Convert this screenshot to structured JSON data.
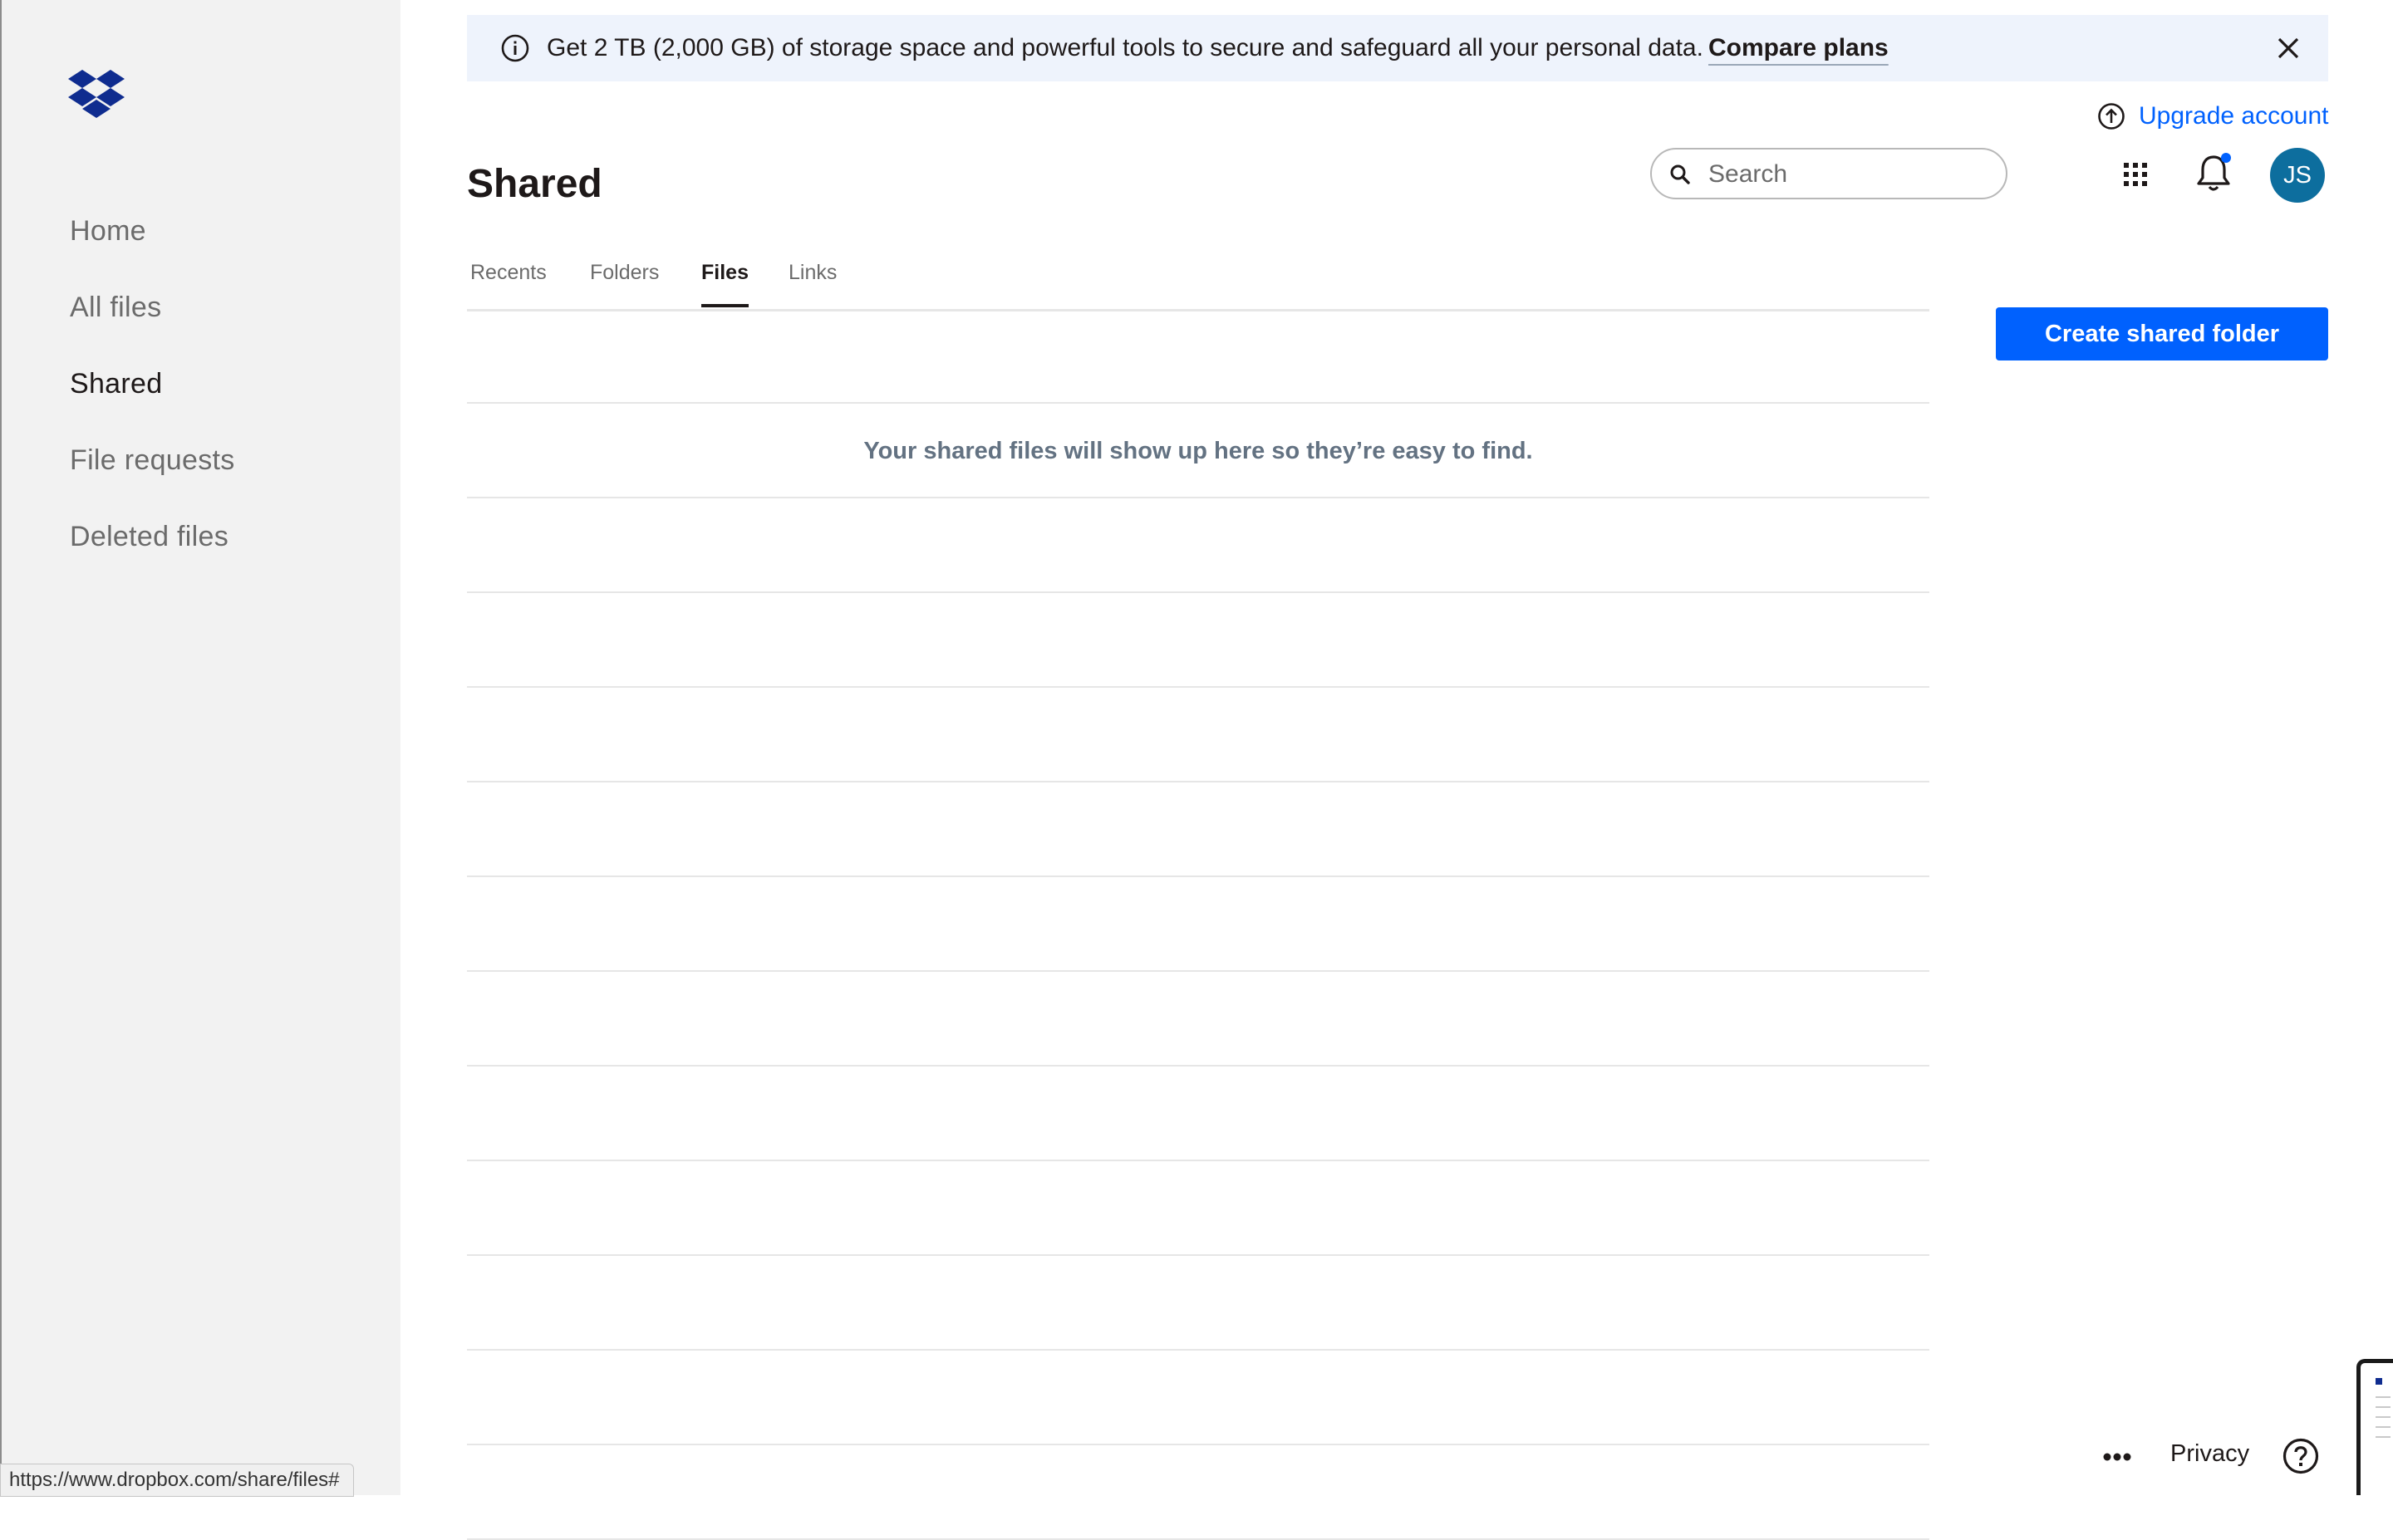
{
  "sidebar": {
    "items": [
      {
        "label": "Home",
        "active": false
      },
      {
        "label": "All files",
        "active": false
      },
      {
        "label": "Shared",
        "active": true
      },
      {
        "label": "File requests",
        "active": false
      },
      {
        "label": "Deleted files",
        "active": false
      }
    ]
  },
  "banner": {
    "icon": "info-icon",
    "message": "Get 2 TB (2,000 GB) of storage space and powerful tools to secure and safeguard all your personal data.",
    "link": "Compare plans",
    "close_icon": "close-icon"
  },
  "header": {
    "upgrade_label": "Upgrade account",
    "title": "Shared",
    "search_placeholder": "Search",
    "avatar_initials": "JS",
    "accent_color": "#0061fe",
    "avatar_color": "#0d6e9e",
    "notification_dot_color": "#0061fe"
  },
  "tabs": [
    {
      "label": "Recents",
      "active": false
    },
    {
      "label": "Folders",
      "active": false
    },
    {
      "label": "Files",
      "active": true
    },
    {
      "label": "Links",
      "active": false
    }
  ],
  "actions": {
    "create_shared_folder": "Create shared folder"
  },
  "content": {
    "empty_message": "Your shared files will show up here so they’re easy to find."
  },
  "statusbar": {
    "url": "https://www.dropbox.com/share/files#"
  },
  "footer": {
    "more_icon": "more-icon",
    "privacy": "Privacy",
    "help_icon": "help-icon"
  }
}
